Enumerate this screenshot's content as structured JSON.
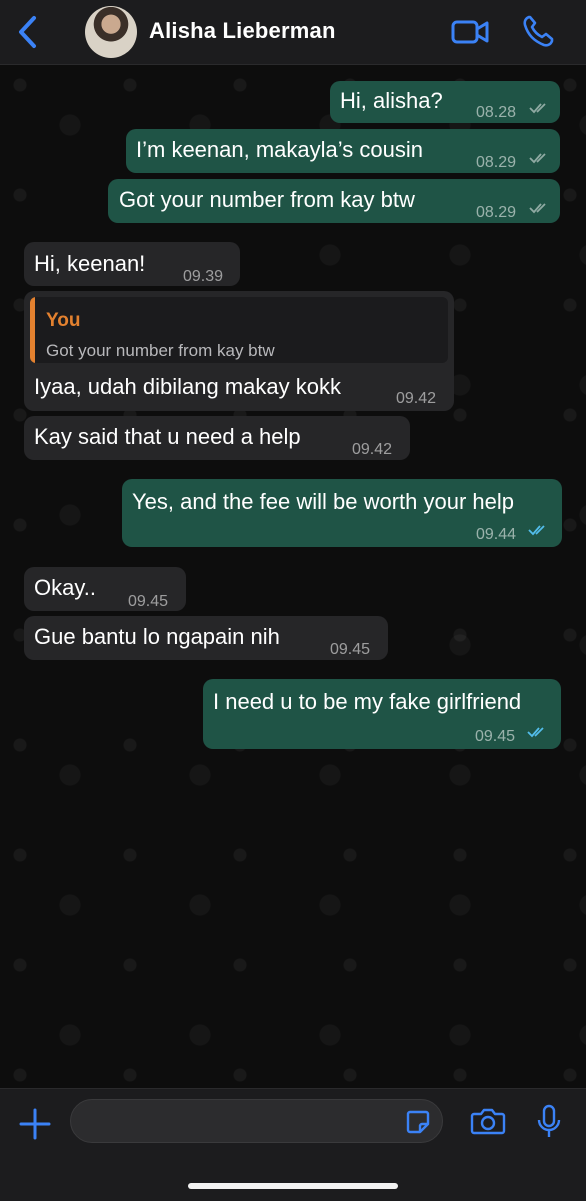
{
  "header": {
    "contact_name": "Alisha Lieberman"
  },
  "icons": {
    "back": "chevron-left-icon",
    "video": "video-camera-icon",
    "call": "phone-icon",
    "plus": "plus-icon",
    "sticker": "sticker-icon",
    "camera": "camera-icon",
    "mic": "microphone-icon"
  },
  "colors": {
    "accent": "#3b82f6",
    "outgoing_bubble": "#1f5446",
    "incoming_bubble": "#262628",
    "quote_accent": "#e3812f",
    "read_ticks": "#53bdeb"
  },
  "messages": [
    {
      "direction": "out",
      "text": "Hi, alisha?",
      "time": "08.28",
      "status": "delivered"
    },
    {
      "direction": "out",
      "text": "I’m keenan, makayla’s cousin",
      "time": "08.29",
      "status": "delivered"
    },
    {
      "direction": "out",
      "text": "Got your number from kay btw",
      "time": "08.29",
      "status": "delivered"
    },
    {
      "direction": "in",
      "text": "Hi, keenan!",
      "time": "09.39"
    },
    {
      "direction": "in",
      "text": "Iyaa, udah dibilang makay kokk",
      "time": "09.42",
      "quote": {
        "name": "You",
        "text": "Got your number from kay btw"
      }
    },
    {
      "direction": "in",
      "text": "Kay said that u need a help",
      "time": "09.42"
    },
    {
      "direction": "out",
      "text": "Yes, and the fee will be worth your help",
      "time": "09.44",
      "status": "read"
    },
    {
      "direction": "in",
      "text": "Okay..",
      "time": "09.45"
    },
    {
      "direction": "in",
      "text": "Gue bantu lo ngapain nih",
      "time": "09.45"
    },
    {
      "direction": "out",
      "text": "I need u to be my fake girlfriend",
      "time": "09.45",
      "status": "read"
    }
  ],
  "composer": {
    "value": "",
    "placeholder": ""
  }
}
